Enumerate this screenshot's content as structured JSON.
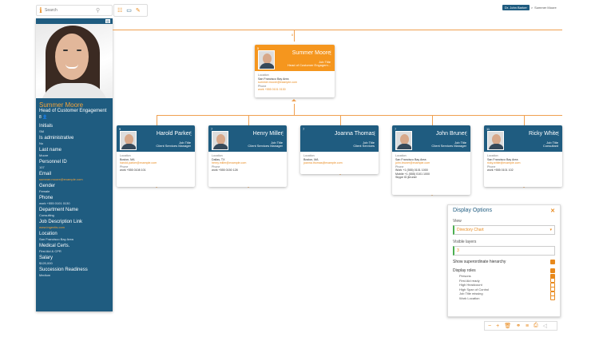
{
  "search": {
    "placeholder": "Search"
  },
  "breadcrumb": {
    "current": "Dr. John Barker",
    "child": "Summer Moore",
    "sep": ">"
  },
  "sidebar": {
    "name": "Summer Moore",
    "job": "Head of Customer Engagement",
    "role_icons": "8 👤",
    "fields": [
      {
        "k": "Initials",
        "v": "SM"
      },
      {
        "k": "Is administrative",
        "v": "No"
      },
      {
        "k": "Last name",
        "v": "Moore"
      },
      {
        "k": "Personnel ID",
        "v": "107"
      },
      {
        "k": "Email",
        "v": "summer.moore@example.com"
      },
      {
        "k": "Gender",
        "v": "Female"
      },
      {
        "k": "Phone",
        "v": "work +555 0101 0130"
      },
      {
        "k": "Department Name",
        "v": "Consulting"
      },
      {
        "k": "Job Description Link",
        "v": "www.ingentis.com"
      },
      {
        "k": "Location",
        "v": "San Francisco Bay Area"
      },
      {
        "k": "Medical Certs.",
        "v": "First Aid & CPR"
      },
      {
        "k": "Salary",
        "v": "$120,000"
      },
      {
        "k": "Succession Readiness",
        "v": "Medium"
      }
    ]
  },
  "root": {
    "count": "5",
    "name": "Summer Moore",
    "jt": "Job Title",
    "title": "Head of Customer Engagem...",
    "loc_l": "Location",
    "loc": "San Francisco Bay Area",
    "email": "summer.moore@example.com",
    "phone_l": "Phone",
    "phone": "work +555 0101 0130",
    "up": "8"
  },
  "cards": [
    {
      "count": "9",
      "name": "Harold Parker",
      "jt": "Job Title",
      "title": "Client Services Manager",
      "loc": "Boston, MA",
      "email": "harold.parker@example.com",
      "phone": "work +555 0108 101"
    },
    {
      "count": "7",
      "name": "Henry Miller",
      "jt": "Job Title",
      "title": "Client Services Manager",
      "loc": "Dallas, TX",
      "email": "henry.miller@example.com",
      "phone": "work +555 0150 128"
    },
    {
      "count": "7",
      "name": "Joanna Thomas",
      "jt": "Job Title",
      "title": "Client Services",
      "loc": "Boston, MA",
      "email": "joanna.thomas@example.com",
      "phone": ""
    },
    {
      "count": "7",
      "name": "John Bruner",
      "jt": "Job Title",
      "title": "Client Services Manager",
      "loc": "San Francisco Bay Area",
      "email": "john.bruner@example.com",
      "phone": "Work +1 (555) 0101 1000",
      "mobile": "Mobile +1 (555) 0101 1000",
      "skype": "Skype ID jbruner"
    },
    {
      "count": "11",
      "name": "Ricky White",
      "jt": "Job Title",
      "title": "Consultant",
      "loc": "San Francisco Bay Area",
      "email": "ricky.white@example.com",
      "phone": "work +555 0101 102"
    }
  ],
  "display": {
    "title": "Display Options",
    "view_label": "View",
    "view_value": "Directory Chart",
    "layers_label": "Visible layers",
    "layers_value": "3",
    "superordinate": "Show superordinate hierarchy",
    "roles_label": "Display roles",
    "roles": [
      "Persons",
      "First Aid ready",
      "High Headcount",
      "High Span of Control",
      "Job Title missing",
      "Work Location"
    ]
  }
}
